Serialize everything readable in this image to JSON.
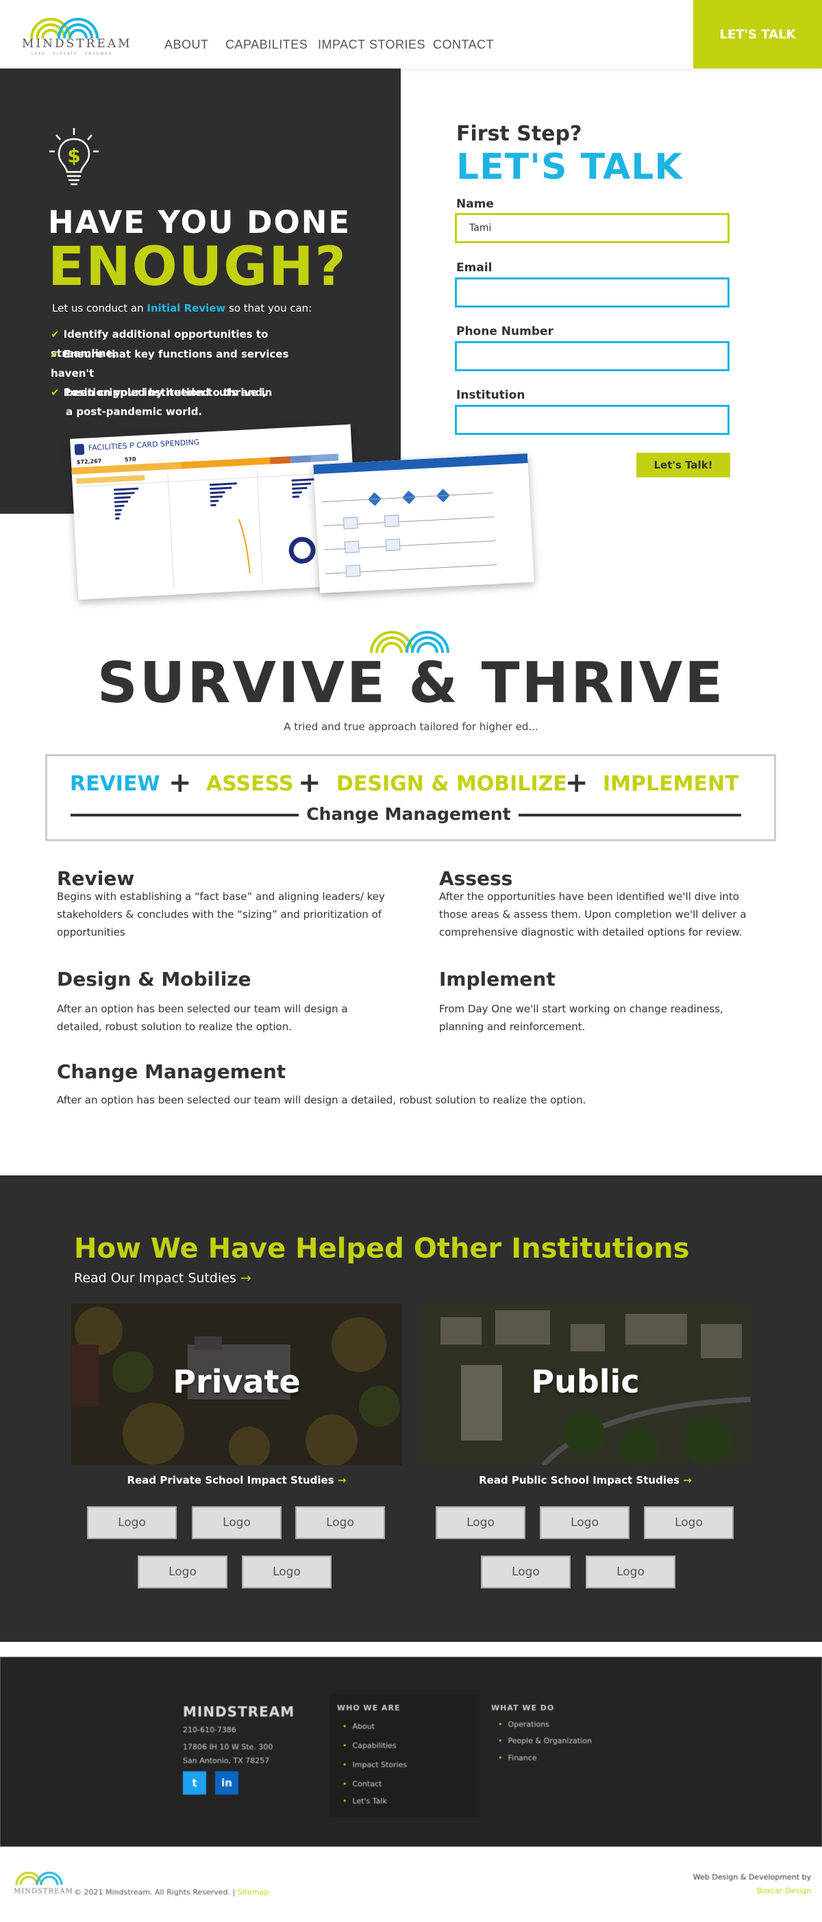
{
  "header": {
    "logo_word": "MINDSTREAM",
    "logo_tag": "LEAD · ELEVATE · EMPOWER",
    "nav": [
      "ABOUT",
      "CAPABILITES",
      "IMPACT STORIES",
      "CONTACT"
    ],
    "cta": "LET'S TALK"
  },
  "hero": {
    "line1": "HAVE YOU DONE",
    "line2": "ENOUGH?",
    "intro_pre": "Let us conduct an ",
    "intro_hl": "Initial Review",
    "intro_post": " so that you can:",
    "bullets": [
      {
        "l1": "Identify additional opportunities to streamline,",
        "l2": ""
      },
      {
        "l1": "Ensure that key functions and services haven't",
        "l2": "been crippled by needed cuts and,"
      },
      {
        "l1": "Position your institution to thrive in",
        "l2": "a post-pandemic world."
      }
    ],
    "dashboard_title": "FACILITIES P CARD SPENDING",
    "dashboard_kpi1": "$72,267",
    "dashboard_kpi2": "570"
  },
  "form": {
    "eyebrow": "First Step?",
    "title": "LET'S TALK",
    "fields": [
      {
        "label": "Name",
        "value": "Tami"
      },
      {
        "label": "Email",
        "value": ""
      },
      {
        "label": "Phone Number",
        "value": ""
      },
      {
        "label": "Institution",
        "value": ""
      }
    ],
    "submit": "Let's Talk!"
  },
  "survive": {
    "title": "SURVIVE & THRIVE",
    "subtitle": "A tried and true approach tailored for higher ed...",
    "steps": [
      "REVIEW",
      "ASSESS",
      "DESIGN & MOBILIZE",
      "IMPLEMENT"
    ],
    "plus": "+",
    "bar_label": "Change Management",
    "phases": [
      {
        "h": "Review",
        "t": "Begins with establishing a “fact base” and aligning leaders/ key stakeholders & concludes with the “sizing” and prioritization of opportunities"
      },
      {
        "h": "Assess",
        "t": "After the opportunities have been identified we'll dive into those areas & assess them. Upon completion we'll deliver a comprehensive diagnostic with detailed options for review."
      },
      {
        "h": "Design & Mobilize",
        "t": "After an option has been selected our team will design a detailed, robust solution to realize the option."
      },
      {
        "h": "Implement",
        "t": "From Day One we'll start working on change readiness, planning and reinforcement."
      },
      {
        "h": "Change Management",
        "t": "After an option has been selected our team will design a detailed, robust solution to realize the option."
      }
    ]
  },
  "impact": {
    "title": "How We Have Helped Other Institutions",
    "sub": "Read Our Impact Sutdies",
    "arrow": "→",
    "private_label": "Private",
    "public_label": "Public",
    "private_link": "Read Private School Impact Studies",
    "public_link": "Read Public School Impact Studies",
    "logo": "Logo"
  },
  "footer": {
    "brand": "MINDSTREAM",
    "phone": "210-610-7386",
    "addr1": "17806 IH 10 W Ste. 300",
    "addr2": "San Antonio, TX 78257",
    "col2_h": "WHO WE ARE",
    "col2": [
      "About",
      "Capabilities",
      "Impact Stories",
      "Contact",
      "Let's Talk"
    ],
    "col3_h": "WHAT WE DO",
    "col3": [
      "Operations",
      "People & Organization",
      "Finance"
    ],
    "copyright": "© 2021 Mindstream. All Rights Reserved. |",
    "sitemap": "Sitemap",
    "credit1": "Web Design & Development by",
    "credit2": "Boxcar Design"
  },
  "colors": {
    "accent_green": "#c2d10f",
    "accent_blue": "#1db4e3",
    "dark": "#2e2e2e"
  }
}
